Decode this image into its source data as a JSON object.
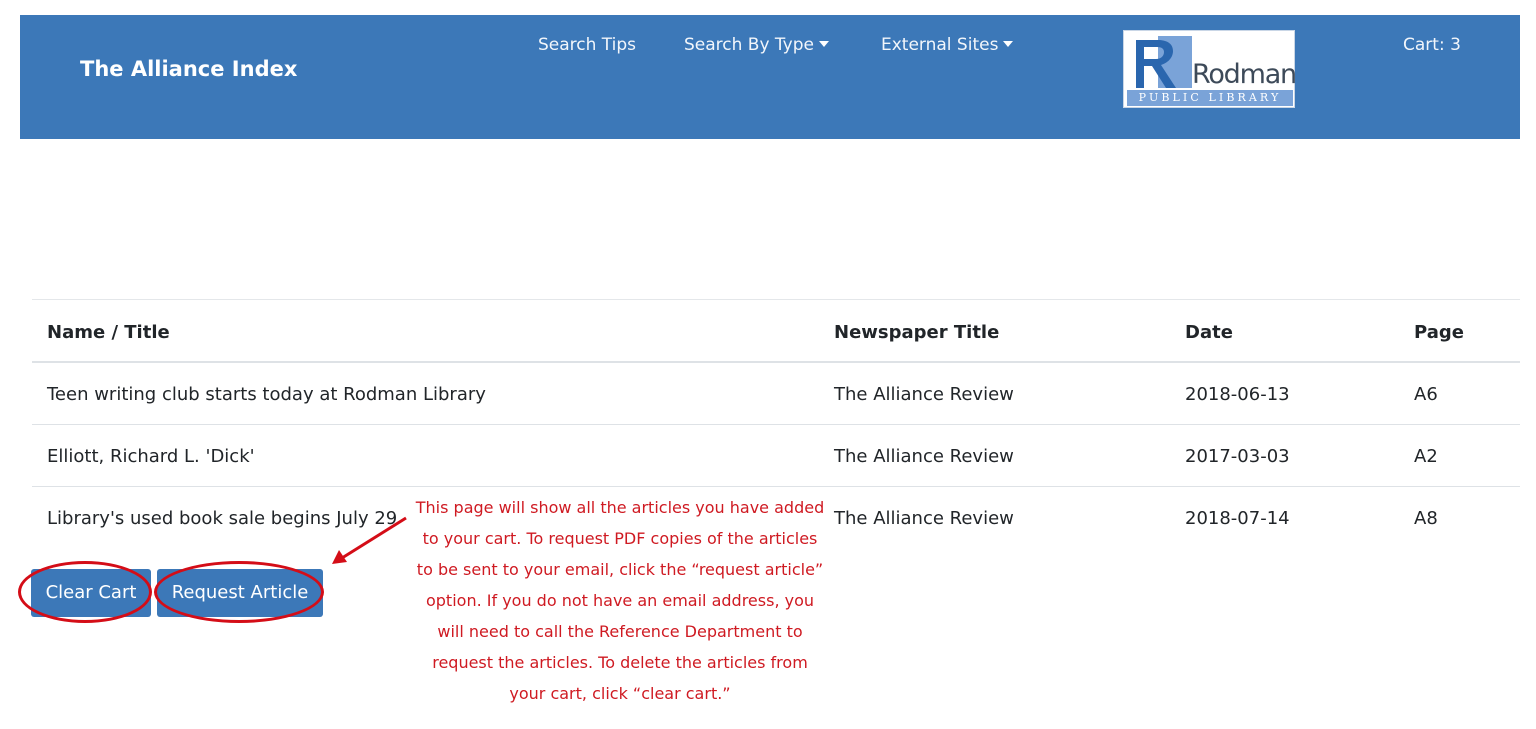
{
  "navbar": {
    "brand": "The Alliance Index",
    "links": [
      {
        "label": "Search Tips",
        "dropdown": false
      },
      {
        "label": "Search By Type",
        "dropdown": true
      },
      {
        "label": "External Sites",
        "dropdown": true
      }
    ],
    "logo": {
      "name": "Rodman",
      "sub": "PUBLIC LIBRARY"
    },
    "cart": "Cart: 3"
  },
  "table": {
    "headers": [
      "Name / Title",
      "Newspaper Title",
      "Date",
      "Page"
    ],
    "rows": [
      [
        "Teen writing club starts today at Rodman Library",
        "The Alliance Review",
        "2018-06-13",
        "A6"
      ],
      [
        "Elliott, Richard L. 'Dick'",
        "The Alliance Review",
        "2017-03-03",
        "A2"
      ],
      [
        "Library's used book sale begins July 29",
        "The Alliance Review",
        "2018-07-14",
        "A8"
      ]
    ]
  },
  "actions": {
    "clear_cart": "Clear Cart",
    "request_article": "Request Article"
  },
  "annotation": {
    "lines": [
      "This page will show all the articles you have added",
      "to your cart. To request PDF copies of the articles",
      "to be sent to your email, click the “request article”",
      "option. If you do not have an email address, you",
      "will need to call the Reference Department to",
      "request the articles. To delete the articles from",
      "your cart, click “clear cart.”"
    ]
  },
  "colors": {
    "brand_blue": "#3c78b8",
    "annotation_red": "#d40d17"
  }
}
